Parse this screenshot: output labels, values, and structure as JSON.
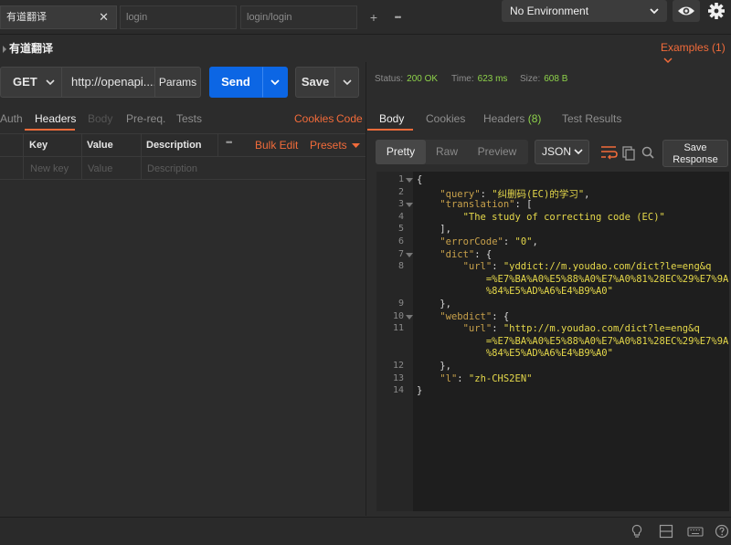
{
  "tabs": [
    {
      "label": "有道翻译",
      "active": true
    },
    {
      "label": "login",
      "active": false
    },
    {
      "label": "login/login",
      "active": false
    }
  ],
  "tab_close": "✕",
  "tab_add": "+",
  "tab_more": "•••",
  "environment": {
    "selected": "No Environment"
  },
  "request": {
    "name": "有道翻译",
    "examples": "Examples (1)",
    "method": "GET",
    "url": "http://openapi....",
    "params": "Params",
    "send": "Send",
    "save": "Save"
  },
  "request_tabs": [
    "Auth",
    "Headers",
    "Body",
    "Pre-req.",
    "Tests"
  ],
  "request_links": {
    "cookies": "Cookies",
    "code": "Code"
  },
  "headers_table": {
    "columns": [
      "Key",
      "Value",
      "Description"
    ],
    "more": "•••",
    "bulk_edit": "Bulk Edit",
    "presets": "Presets",
    "placeholders": {
      "key": "New key",
      "value": "Value",
      "description": "Description"
    }
  },
  "status": {
    "status_label": "Status:",
    "status_value": "200 OK",
    "time_label": "Time:",
    "time_value": "623 ms",
    "size_label": "Size:",
    "size_value": "608 B"
  },
  "response_tabs": {
    "body": "Body",
    "cookies": "Cookies",
    "headers": "Headers",
    "headers_count": "(8)",
    "test_results": "Test Results"
  },
  "response_toolbar": {
    "views": [
      "Pretty",
      "Raw",
      "Preview"
    ],
    "format": "JSON",
    "save_response_line1": "Save",
    "save_response_line2": "Response"
  },
  "code_lines": [
    {
      "n": "1",
      "fold": true,
      "parts": [
        {
          "t": "{",
          "c": "p"
        }
      ]
    },
    {
      "n": "2",
      "fold": false,
      "parts": [
        {
          "t": "    ",
          "c": "p"
        },
        {
          "t": "\"query\"",
          "c": "k"
        },
        {
          "t": ": ",
          "c": "p"
        },
        {
          "t": "\"纠删码(EC)的学习\"",
          "c": "s"
        },
        {
          "t": ",",
          "c": "p"
        }
      ]
    },
    {
      "n": "3",
      "fold": true,
      "parts": [
        {
          "t": "    ",
          "c": "p"
        },
        {
          "t": "\"translation\"",
          "c": "k"
        },
        {
          "t": ": [",
          "c": "p"
        }
      ]
    },
    {
      "n": "4",
      "fold": false,
      "parts": [
        {
          "t": "        ",
          "c": "p"
        },
        {
          "t": "\"The study of correcting code (EC)\"",
          "c": "s"
        }
      ]
    },
    {
      "n": "5",
      "fold": false,
      "parts": [
        {
          "t": "    ],",
          "c": "p"
        }
      ]
    },
    {
      "n": "6",
      "fold": false,
      "parts": [
        {
          "t": "    ",
          "c": "p"
        },
        {
          "t": "\"errorCode\"",
          "c": "k"
        },
        {
          "t": ": ",
          "c": "p"
        },
        {
          "t": "\"0\"",
          "c": "s"
        },
        {
          "t": ",",
          "c": "p"
        }
      ]
    },
    {
      "n": "7",
      "fold": true,
      "parts": [
        {
          "t": "    ",
          "c": "p"
        },
        {
          "t": "\"dict\"",
          "c": "k"
        },
        {
          "t": ": {",
          "c": "p"
        }
      ]
    },
    {
      "n": "8",
      "fold": false,
      "parts": [
        {
          "t": "        ",
          "c": "p"
        },
        {
          "t": "\"url\"",
          "c": "k"
        },
        {
          "t": ": ",
          "c": "p"
        },
        {
          "t": "\"yddict://m.youdao.com/dict?le=eng&q",
          "c": "s"
        }
      ]
    },
    {
      "n": "",
      "fold": false,
      "parts": [
        {
          "t": "            ",
          "c": "p"
        },
        {
          "t": "=%E7%BA%A0%E5%88%A0%E7%A0%81%28EC%29%E7%9A",
          "c": "s"
        }
      ]
    },
    {
      "n": "",
      "fold": false,
      "parts": [
        {
          "t": "            ",
          "c": "p"
        },
        {
          "t": "%84%E5%AD%A6%E4%B9%A0\"",
          "c": "s"
        }
      ]
    },
    {
      "n": "9",
      "fold": false,
      "parts": [
        {
          "t": "    },",
          "c": "p"
        }
      ]
    },
    {
      "n": "10",
      "fold": true,
      "parts": [
        {
          "t": "    ",
          "c": "p"
        },
        {
          "t": "\"webdict\"",
          "c": "k"
        },
        {
          "t": ": {",
          "c": "p"
        }
      ]
    },
    {
      "n": "11",
      "fold": false,
      "parts": [
        {
          "t": "        ",
          "c": "p"
        },
        {
          "t": "\"url\"",
          "c": "k"
        },
        {
          "t": ": ",
          "c": "p"
        },
        {
          "t": "\"http://m.youdao.com/dict?le=eng&q",
          "c": "s"
        }
      ]
    },
    {
      "n": "",
      "fold": false,
      "parts": [
        {
          "t": "            ",
          "c": "p"
        },
        {
          "t": "=%E7%BA%A0%E5%88%A0%E7%A0%81%28EC%29%E7%9A",
          "c": "s"
        }
      ]
    },
    {
      "n": "",
      "fold": false,
      "parts": [
        {
          "t": "            ",
          "c": "p"
        },
        {
          "t": "%84%E5%AD%A6%E4%B9%A0\"",
          "c": "s"
        }
      ]
    },
    {
      "n": "12",
      "fold": false,
      "parts": [
        {
          "t": "    },",
          "c": "p"
        }
      ]
    },
    {
      "n": "13",
      "fold": false,
      "parts": [
        {
          "t": "    ",
          "c": "p"
        },
        {
          "t": "\"l\"",
          "c": "k"
        },
        {
          "t": ": ",
          "c": "p"
        },
        {
          "t": "\"zh-CHS2EN\"",
          "c": "s"
        }
      ]
    },
    {
      "n": "14",
      "fold": false,
      "parts": [
        {
          "t": "}",
          "c": "p"
        }
      ]
    }
  ],
  "icons": {
    "bottom": [
      "lightbulb-icon",
      "two-pane-icon",
      "keyboard-icon",
      "help-icon"
    ]
  },
  "colors": {
    "accent": "#f26b3a",
    "send": "#0c66e4",
    "status_ok": "#8ed24a"
  }
}
